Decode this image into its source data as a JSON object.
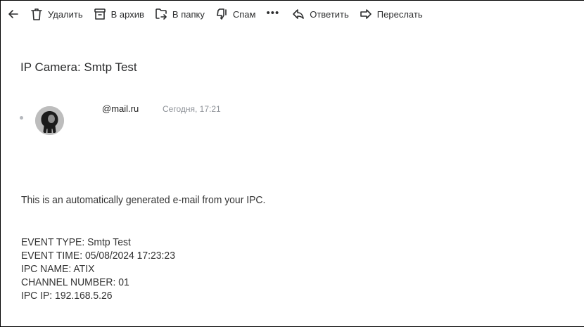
{
  "toolbar": {
    "back_icon": "arrow-left-icon",
    "items": [
      {
        "icon": "trash-icon",
        "label": "Удалить"
      },
      {
        "icon": "archive-icon",
        "label": "В архив"
      },
      {
        "icon": "folder-icon",
        "label": "В папку"
      },
      {
        "icon": "spam-icon",
        "label": "Спам"
      },
      {
        "icon": "more-icon",
        "label": "•••"
      },
      {
        "icon": "reply-icon",
        "label": "Ответить"
      },
      {
        "icon": "forward-icon",
        "label": "Переслать"
      }
    ]
  },
  "message": {
    "subject": "IP Camera: Smtp Test",
    "sender": "@mail.ru",
    "date": "Сегодня, 17:21",
    "intro": "This is an automatically generated e-mail from your IPC.",
    "details": [
      "EVENT TYPE: Smtp Test",
      "EVENT TIME: 05/08/2024 17:23:23",
      "IPC NAME: ATIX",
      "CHANNEL NUMBER: 01",
      "IPC IP: 192.168.5.26"
    ]
  },
  "colors": {
    "text": "#2c2d2e",
    "muted": "#8f9399",
    "avatar_bg": "#b9b9b9"
  }
}
